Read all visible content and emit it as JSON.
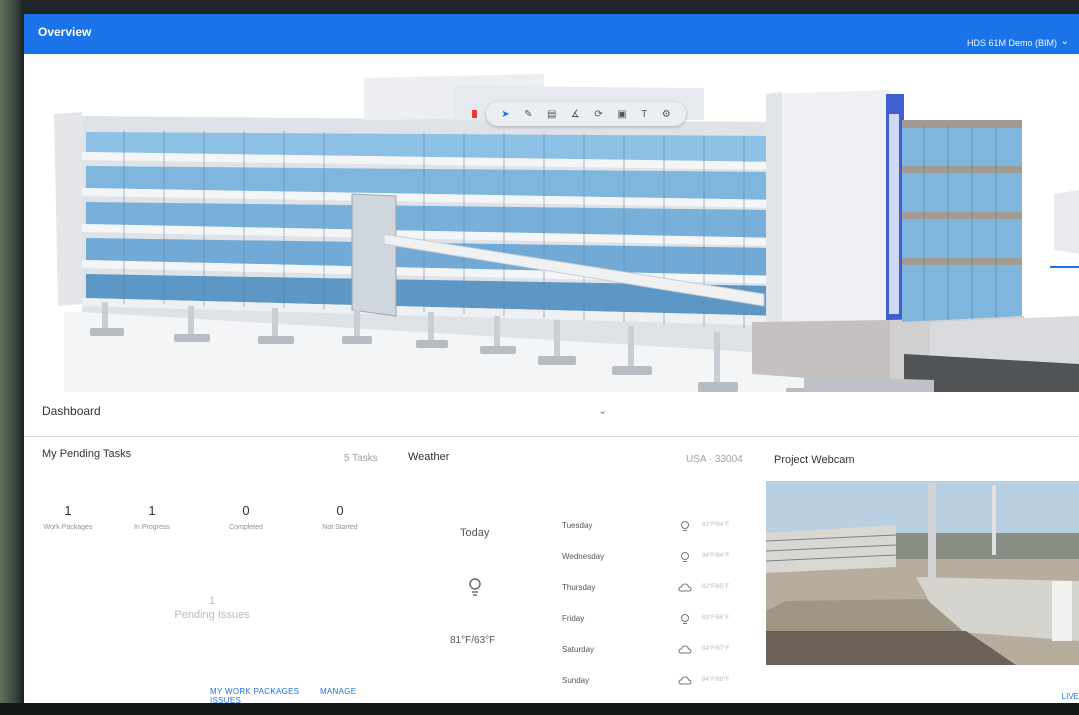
{
  "header": {
    "title": "Overview",
    "project_name": "HDS 61M Demo (BIM)"
  },
  "viewer": {
    "toolbar_icons": [
      "cursor-icon",
      "pencil-icon",
      "section-icon",
      "measure-icon",
      "rotate-icon",
      "layers-icon",
      "text-icon",
      "settings-icon"
    ]
  },
  "dashboard": {
    "label": "Dashboard"
  },
  "tasks": {
    "title": "My Pending Tasks",
    "count_label": "5 Tasks",
    "stats": [
      {
        "value": "1",
        "label": "Work Packages"
      },
      {
        "value": "1",
        "label": "In Progress"
      },
      {
        "value": "0",
        "label": "Completed"
      },
      {
        "value": "0",
        "label": "Not Started"
      }
    ],
    "pending_count": "1",
    "pending_label": "Pending Issues",
    "link_work_packages": "MY WORK PACKAGES",
    "link_manage_issues": "MANAGE ISSUES"
  },
  "weather": {
    "title": "Weather",
    "location": "USA · 33004",
    "today_label": "Today",
    "today_temp": "81°F/63°F",
    "days": [
      {
        "day": "Tuesday",
        "temp": "82°F/64°F",
        "icon": "sun-icon"
      },
      {
        "day": "Wednesday",
        "temp": "84°F/64°F",
        "icon": "sun-icon"
      },
      {
        "day": "Thursday",
        "temp": "82°F/65°F",
        "icon": "cloud-icon"
      },
      {
        "day": "Friday",
        "temp": "83°F/66°F",
        "icon": "sun-icon"
      },
      {
        "day": "Saturday",
        "temp": "84°F/67°F",
        "icon": "cloud-icon"
      },
      {
        "day": "Sunday",
        "temp": "84°F/68°F",
        "icon": "cloud-icon"
      }
    ]
  },
  "webcam": {
    "title": "Project Webcam",
    "live_label": "LIVE"
  },
  "colors": {
    "accent": "#1a73e8",
    "glass": "#7fb8e0",
    "slab": "#eef0f2"
  }
}
